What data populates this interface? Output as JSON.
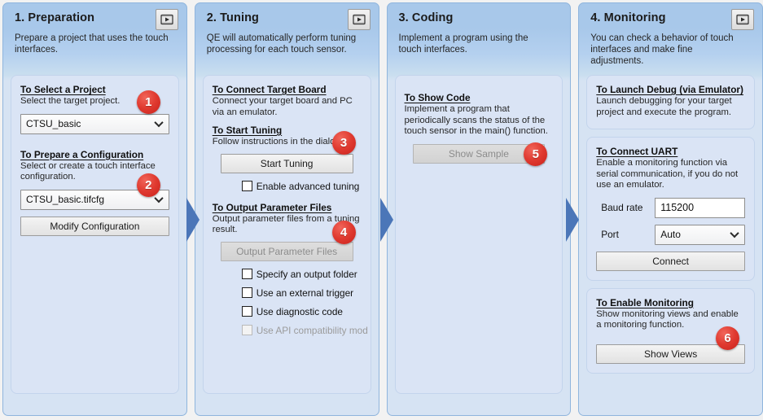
{
  "colors": {
    "header_blue": "#a8c8ea",
    "card_blue": "#dae4f5",
    "badge_red": "#e03a30",
    "arrow_blue": "#3f6db5"
  },
  "icons": {
    "video": "video-play-icon",
    "dropdown": "chevron-down-icon"
  },
  "columns": [
    {
      "title": "1. Preparation",
      "description": "Prepare a project that uses the touch interfaces.",
      "has_video_button": true,
      "sections": [
        {
          "heading": "To Select a Project",
          "text": "Select the target project.",
          "badge": "1",
          "controls": [
            {
              "type": "combo",
              "name": "project-select",
              "value": "CTSU_basic"
            }
          ]
        },
        {
          "heading": "To Prepare a Configuration",
          "text": "Select or create a touch interface configuration.",
          "badge": "2",
          "controls": [
            {
              "type": "combo",
              "name": "configuration-select",
              "value": "CTSU_basic.tifcfg"
            },
            {
              "type": "button",
              "name": "modify-configuration-button",
              "label": "Modify Configuration",
              "disabled": false
            }
          ]
        }
      ]
    },
    {
      "title": "2. Tuning",
      "description": "QE will automatically perform tuning processing for each touch sensor.",
      "has_video_button": true,
      "sections": [
        {
          "heading": "To Connect Target Board",
          "text": "Connect your target board and PC via an emulator."
        },
        {
          "heading": "To Start Tuning",
          "text": "Follow instructions in the dialog.",
          "badge": "3",
          "controls": [
            {
              "type": "button",
              "name": "start-tuning-button",
              "label": "Start Tuning",
              "disabled": false
            },
            {
              "type": "checkbox",
              "name": "enable-advanced-tuning-checkbox",
              "label": "Enable advanced tuning",
              "checked": false,
              "disabled": false
            }
          ]
        },
        {
          "heading": "To Output Parameter Files",
          "text": "Output parameter files from a tuning result.",
          "badge": "4",
          "controls": [
            {
              "type": "button",
              "name": "output-parameter-files-button",
              "label": "Output Parameter Files",
              "disabled": true
            },
            {
              "type": "checkbox",
              "name": "specify-output-folder-checkbox",
              "label": "Specify an output folder",
              "checked": false,
              "disabled": false
            },
            {
              "type": "checkbox",
              "name": "use-external-trigger-checkbox",
              "label": "Use an external trigger",
              "checked": false,
              "disabled": false
            },
            {
              "type": "checkbox",
              "name": "use-diagnostic-code-checkbox",
              "label": "Use diagnostic code",
              "checked": false,
              "disabled": false
            },
            {
              "type": "checkbox",
              "name": "use-api-compatibility-mode-checkbox",
              "label": "Use API compatibility mod",
              "checked": false,
              "disabled": true
            }
          ]
        }
      ]
    },
    {
      "title": "3. Coding",
      "description": "Implement a program using the touch interfaces.",
      "has_video_button": false,
      "sections": [
        {
          "heading": "To Show Code",
          "text": "Implement a program that periodically scans the status of the touch sensor in the main() function.",
          "badge": "5",
          "controls": [
            {
              "type": "button",
              "name": "show-sample-button",
              "label": "Show Sample",
              "disabled": true
            }
          ]
        }
      ]
    },
    {
      "title": "4. Monitoring",
      "description": "You can check a behavior of touch interfaces and make fine adjustments.",
      "has_video_button": true,
      "sections": [
        {
          "heading": "To Launch Debug (via Emulator)",
          "text": "Launch debugging for your target project and execute the program."
        },
        {
          "heading": "To Connect UART",
          "text": "Enable a monitoring function via serial communication, if you do not use an emulator.",
          "fields": [
            {
              "label": "Baud rate",
              "name": "baud-rate-input",
              "type": "textbox",
              "value": "115200"
            },
            {
              "label": "Port",
              "name": "port-select",
              "type": "combo",
              "value": "Auto"
            }
          ],
          "controls": [
            {
              "type": "button",
              "name": "connect-button",
              "label": "Connect",
              "disabled": false
            }
          ]
        },
        {
          "heading": "To Enable Monitoring",
          "text": "Show monitoring views and enable a monitoring function.",
          "badge": "6",
          "controls": [
            {
              "type": "button",
              "name": "show-views-button",
              "label": "Show Views",
              "disabled": false
            }
          ]
        }
      ]
    }
  ]
}
